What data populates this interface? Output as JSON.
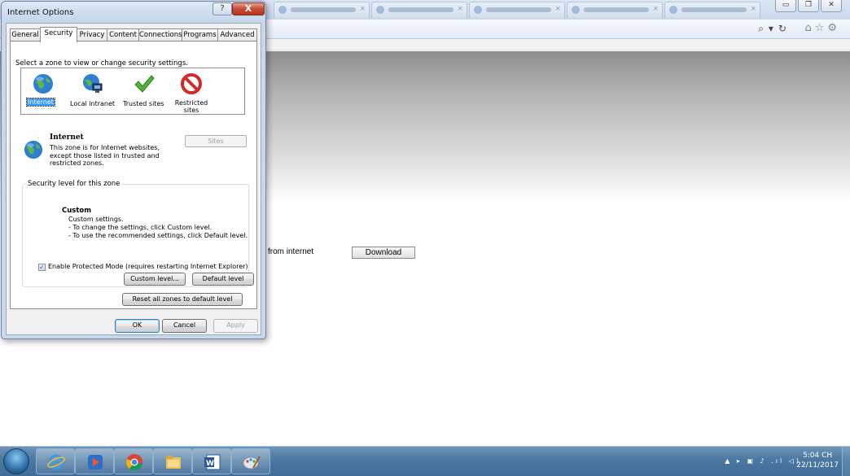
{
  "browser": {
    "page_label": "from internet",
    "download_label": "Download"
  },
  "dialog": {
    "title": "Internet Options",
    "help_label": "?",
    "close_label": "X",
    "tabs": [
      {
        "label": "General",
        "active": false
      },
      {
        "label": "Security",
        "active": true
      },
      {
        "label": "Privacy",
        "active": false
      },
      {
        "label": "Content",
        "active": false
      },
      {
        "label": "Connections",
        "active": false
      },
      {
        "label": "Programs",
        "active": false
      },
      {
        "label": "Advanced",
        "active": false
      }
    ],
    "zone_prompt": "Select a zone to view or change security settings.",
    "zones": [
      {
        "label": "Internet",
        "icon": "globe-icon",
        "selected": true
      },
      {
        "label": "Local intranet",
        "icon": "intranet-icon",
        "selected": false
      },
      {
        "label": "Trusted sites",
        "icon": "checkmark-icon",
        "selected": false
      },
      {
        "label": "Restricted sites",
        "icon": "restricted-icon",
        "selected": false
      }
    ],
    "zone_info": {
      "name": "Internet",
      "description": "This zone is for Internet websites, except those listed in trusted and restricted zones.",
      "sites_label": "Sites"
    },
    "security_level": {
      "legend": "Security level for this zone",
      "title": "Custom",
      "lines": [
        "Custom settings.",
        "- To change the settings, click Custom level.",
        "- To use the recommended settings, click Default level."
      ],
      "protected_mode_label": "Enable Protected Mode (requires restarting Internet Explorer)",
      "protected_mode_checked": true,
      "custom_level_label": "Custom level...",
      "default_level_label": "Default level"
    },
    "reset_label": "Reset all zones to default level",
    "ok_label": "OK",
    "cancel_label": "Cancel",
    "apply_label": "Apply"
  },
  "taskbar": {
    "apps": [
      "internet-explorer-icon",
      "media-player-icon",
      "chrome-icon",
      "file-explorer-icon",
      "word-icon",
      "paint-icon"
    ],
    "clock_time": "5:04 CH",
    "clock_date": "22/11/2017"
  },
  "colors": {
    "selection": "#3399ff",
    "taskbar": "#4d7aa3",
    "close_button": "#c44a35"
  }
}
